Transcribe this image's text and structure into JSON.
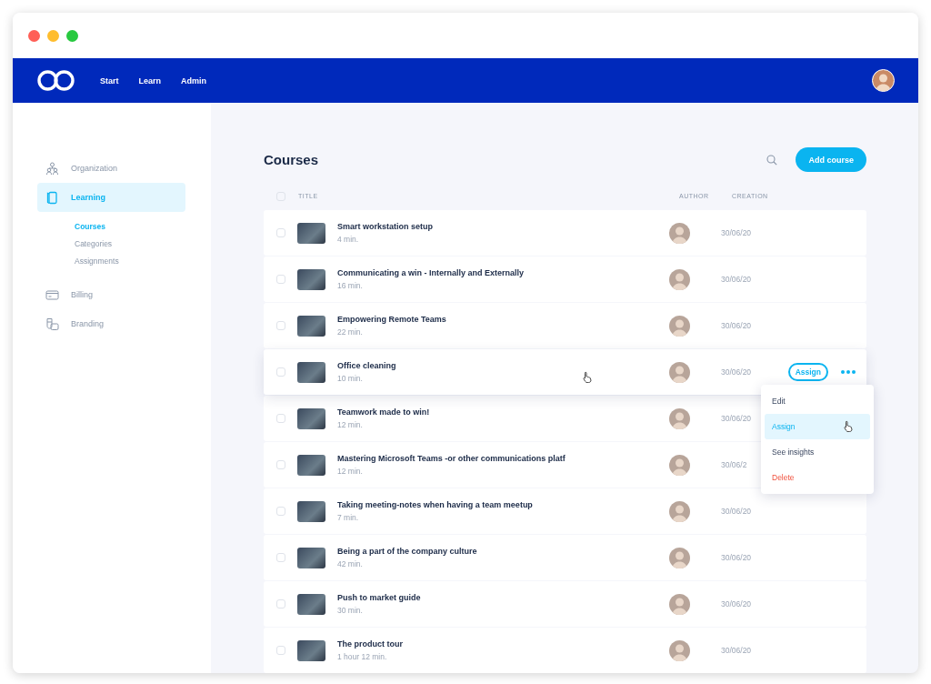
{
  "nav": {
    "links": [
      {
        "label": "Start"
      },
      {
        "label": "Learn"
      },
      {
        "label": "Admin"
      }
    ]
  },
  "sidebar": {
    "items": [
      {
        "label": "Organization",
        "kind": "organization",
        "selected": false
      },
      {
        "label": "Learning",
        "kind": "learning",
        "selected": true,
        "children": [
          {
            "label": "Courses",
            "selected": true
          },
          {
            "label": "Categories",
            "selected": false
          },
          {
            "label": "Assignments",
            "selected": false
          }
        ]
      },
      {
        "label": "Billing",
        "kind": "billing",
        "selected": false
      },
      {
        "label": "Branding",
        "kind": "branding",
        "selected": false
      }
    ]
  },
  "page": {
    "title": "Courses",
    "add_button": "Add course"
  },
  "table": {
    "header_checked": false,
    "columns": [
      "TITLE",
      "AUTHOR",
      "CREATION"
    ],
    "rows": [
      {
        "title": "Smart workstation setup",
        "duration": "4 min.",
        "date": "30/06/20",
        "checked": false,
        "hovered": false
      },
      {
        "title": "Communicating a win - Internally and Externally",
        "duration": "16 min.",
        "date": "30/06/20",
        "checked": false,
        "hovered": false
      },
      {
        "title": "Empowering Remote Teams",
        "duration": "22 min.",
        "date": "30/06/20",
        "checked": false,
        "hovered": false
      },
      {
        "title": "Office cleaning",
        "duration": "10 min.",
        "date": "30/06/20",
        "checked": false,
        "hovered": true,
        "action": "Assign"
      },
      {
        "title": "Teamwork made to win!",
        "duration": "12 min.",
        "date": "30/06/20",
        "checked": false,
        "hovered": false
      },
      {
        "title": "Mastering Microsoft Teams -or other communications platf",
        "duration": "12 min.",
        "date": "30/06/2",
        "checked": false,
        "hovered": false
      },
      {
        "title": "Taking meeting-notes when having a team meetup",
        "duration": "7 min.",
        "date": "30/06/20",
        "checked": false,
        "hovered": false
      },
      {
        "title": "Being a part of the company culture",
        "duration": "42 min.",
        "date": "30/06/20",
        "checked": false,
        "hovered": false
      },
      {
        "title": "Push to market guide",
        "duration": "30 min.",
        "date": "30/06/20",
        "checked": false,
        "hovered": false
      },
      {
        "title": "The product tour",
        "duration": "1 hour 12 min.",
        "date": "30/06/20",
        "checked": false,
        "hovered": false
      }
    ]
  },
  "menu": {
    "items": [
      {
        "label": "Edit",
        "kind": "normal",
        "selected": false
      },
      {
        "label": "Assign",
        "kind": "normal",
        "selected": true
      },
      {
        "label": "See insights",
        "kind": "normal",
        "selected": false
      },
      {
        "label": "Delete",
        "kind": "danger",
        "selected": false
      }
    ]
  }
}
